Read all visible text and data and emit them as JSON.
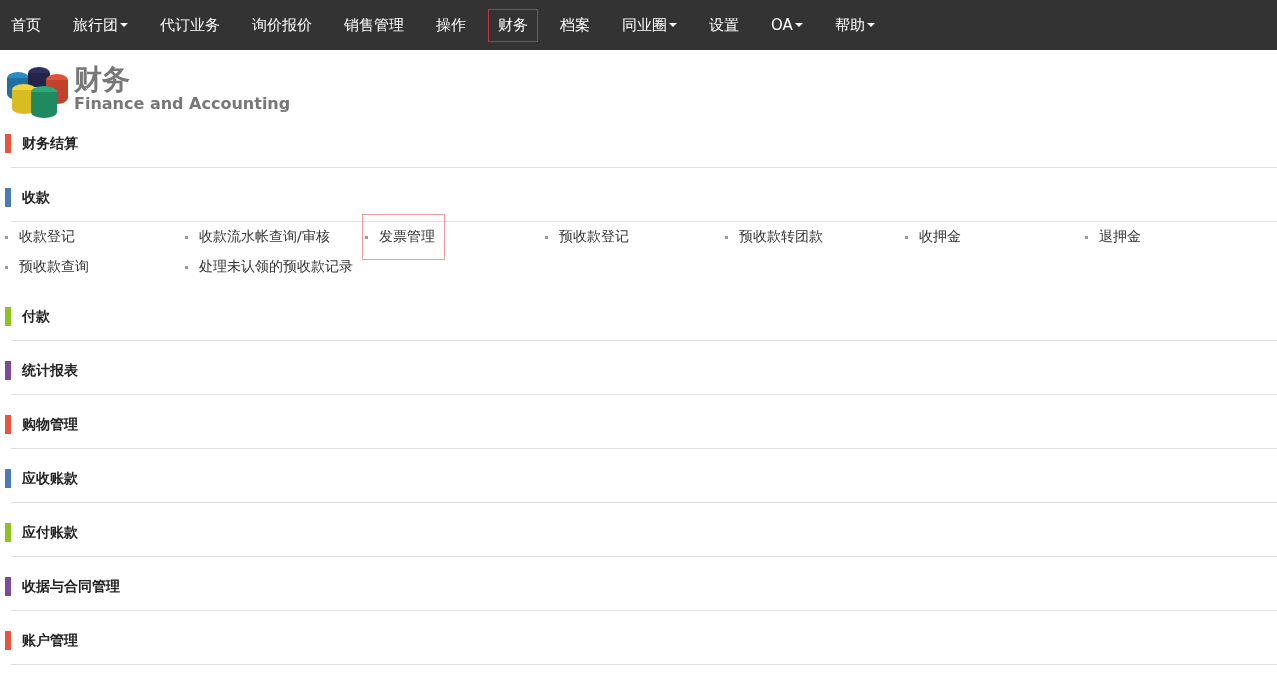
{
  "nav": [
    {
      "label": "首页",
      "dropdown": false,
      "selected": false
    },
    {
      "label": "旅行团",
      "dropdown": true,
      "selected": false
    },
    {
      "label": "代订业务",
      "dropdown": false,
      "selected": false
    },
    {
      "label": "询价报价",
      "dropdown": false,
      "selected": false
    },
    {
      "label": "销售管理",
      "dropdown": false,
      "selected": false
    },
    {
      "label": "操作",
      "dropdown": false,
      "selected": false
    },
    {
      "label": "财务",
      "dropdown": false,
      "selected": true
    },
    {
      "label": "档案",
      "dropdown": false,
      "selected": false
    },
    {
      "label": "同业圈",
      "dropdown": true,
      "selected": false
    },
    {
      "label": "设置",
      "dropdown": false,
      "selected": false
    },
    {
      "label": "OA",
      "dropdown": true,
      "selected": false
    },
    {
      "label": "帮助",
      "dropdown": true,
      "selected": false
    }
  ],
  "header": {
    "title": "财务",
    "subtitle": "Finance and Accounting"
  },
  "sections": [
    {
      "title": "财务结算",
      "color": "#e8543c"
    },
    {
      "title": "收款",
      "color": "#4a7ab8",
      "links": [
        {
          "label": "收款登记",
          "selected": false
        },
        {
          "label": "收款流水帐查询/审核",
          "selected": false
        },
        {
          "label": "发票管理",
          "selected": true
        },
        {
          "label": "预收款登记",
          "selected": false
        },
        {
          "label": "预收款转团款",
          "selected": false
        },
        {
          "label": "收押金",
          "selected": false
        },
        {
          "label": "退押金",
          "selected": false
        },
        {
          "label": "预收款查询",
          "selected": false
        },
        {
          "label": "处理未认领的预收款记录",
          "selected": false
        }
      ]
    },
    {
      "title": "付款",
      "color": "#8dc21f"
    },
    {
      "title": "统计报表",
      "color": "#7b4a9c"
    },
    {
      "title": "购物管理",
      "color": "#e8543c"
    },
    {
      "title": "应收账款",
      "color": "#4a7ab8"
    },
    {
      "title": "应付账款",
      "color": "#8dc21f"
    },
    {
      "title": "收据与合同管理",
      "color": "#7b4a9c"
    },
    {
      "title": "账户管理",
      "color": "#e8543c"
    }
  ]
}
